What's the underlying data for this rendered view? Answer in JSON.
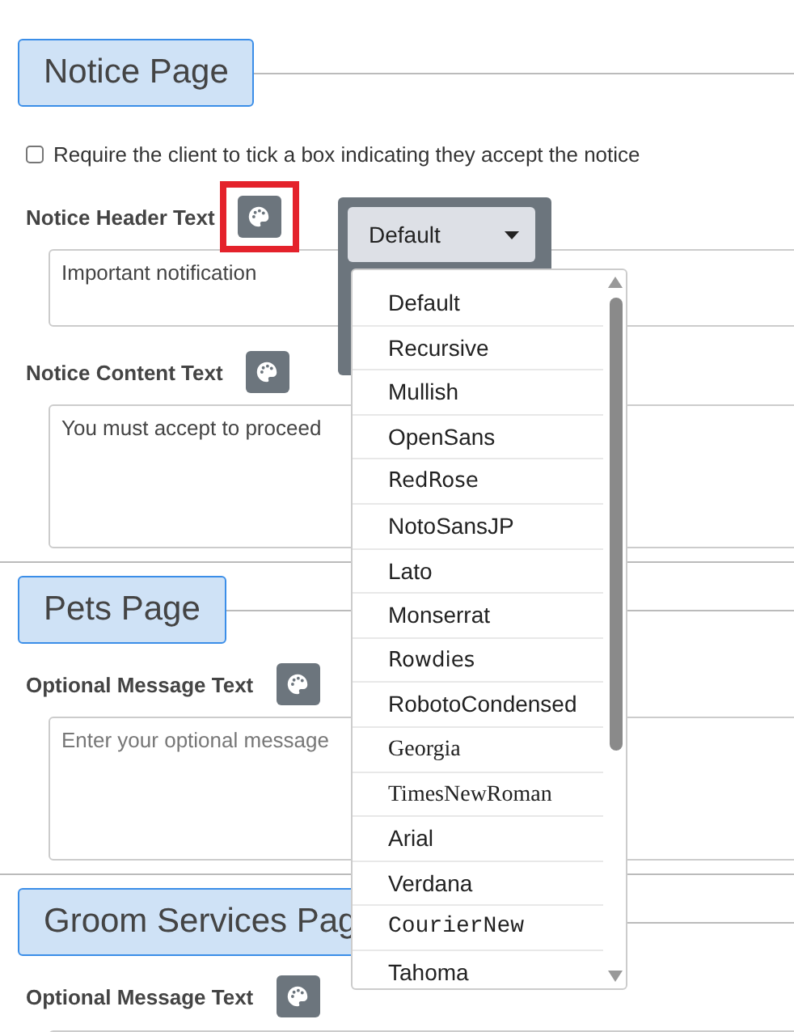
{
  "sections": [
    {
      "title": "Notice Page",
      "checkbox": {
        "label": "Require the client to tick a box indicating they accept the notice",
        "checked": false
      },
      "fields": [
        {
          "label": "Notice Header Text",
          "highlighted": true,
          "value": "Important notification"
        },
        {
          "label": "Notice Content Text",
          "highlighted": false,
          "value": "You must accept to proceed"
        }
      ]
    },
    {
      "title": "Pets Page",
      "fields": [
        {
          "label": "Optional Message Text",
          "highlighted": false,
          "placeholder": "Enter your optional message"
        }
      ]
    },
    {
      "title": "Groom Services Pag",
      "fields": [
        {
          "label": "Optional Message Text",
          "highlighted": false
        }
      ]
    }
  ],
  "font_picker": {
    "current": "Default",
    "options": [
      {
        "label": "Default",
        "kind": "sans"
      },
      {
        "label": "Recursive",
        "kind": "sans"
      },
      {
        "label": "Mullish",
        "kind": "sans"
      },
      {
        "label": "OpenSans",
        "kind": "sans"
      },
      {
        "label": "RedRose",
        "kind": "display"
      },
      {
        "label": "NotoSansJP",
        "kind": "sans"
      },
      {
        "label": "Lato",
        "kind": "sans"
      },
      {
        "label": "Monserrat",
        "kind": "sans"
      },
      {
        "label": "Rowdies",
        "kind": "display"
      },
      {
        "label": "RobotoCondensed",
        "kind": "sans"
      },
      {
        "label": "Georgia",
        "kind": "serif"
      },
      {
        "label": "TimesNewRoman",
        "kind": "serif"
      },
      {
        "label": "Arial",
        "kind": "sans"
      },
      {
        "label": "Verdana",
        "kind": "sans"
      },
      {
        "label": "CourierNew",
        "kind": "mono"
      },
      {
        "label": "Tahoma",
        "kind": "sans"
      }
    ]
  }
}
